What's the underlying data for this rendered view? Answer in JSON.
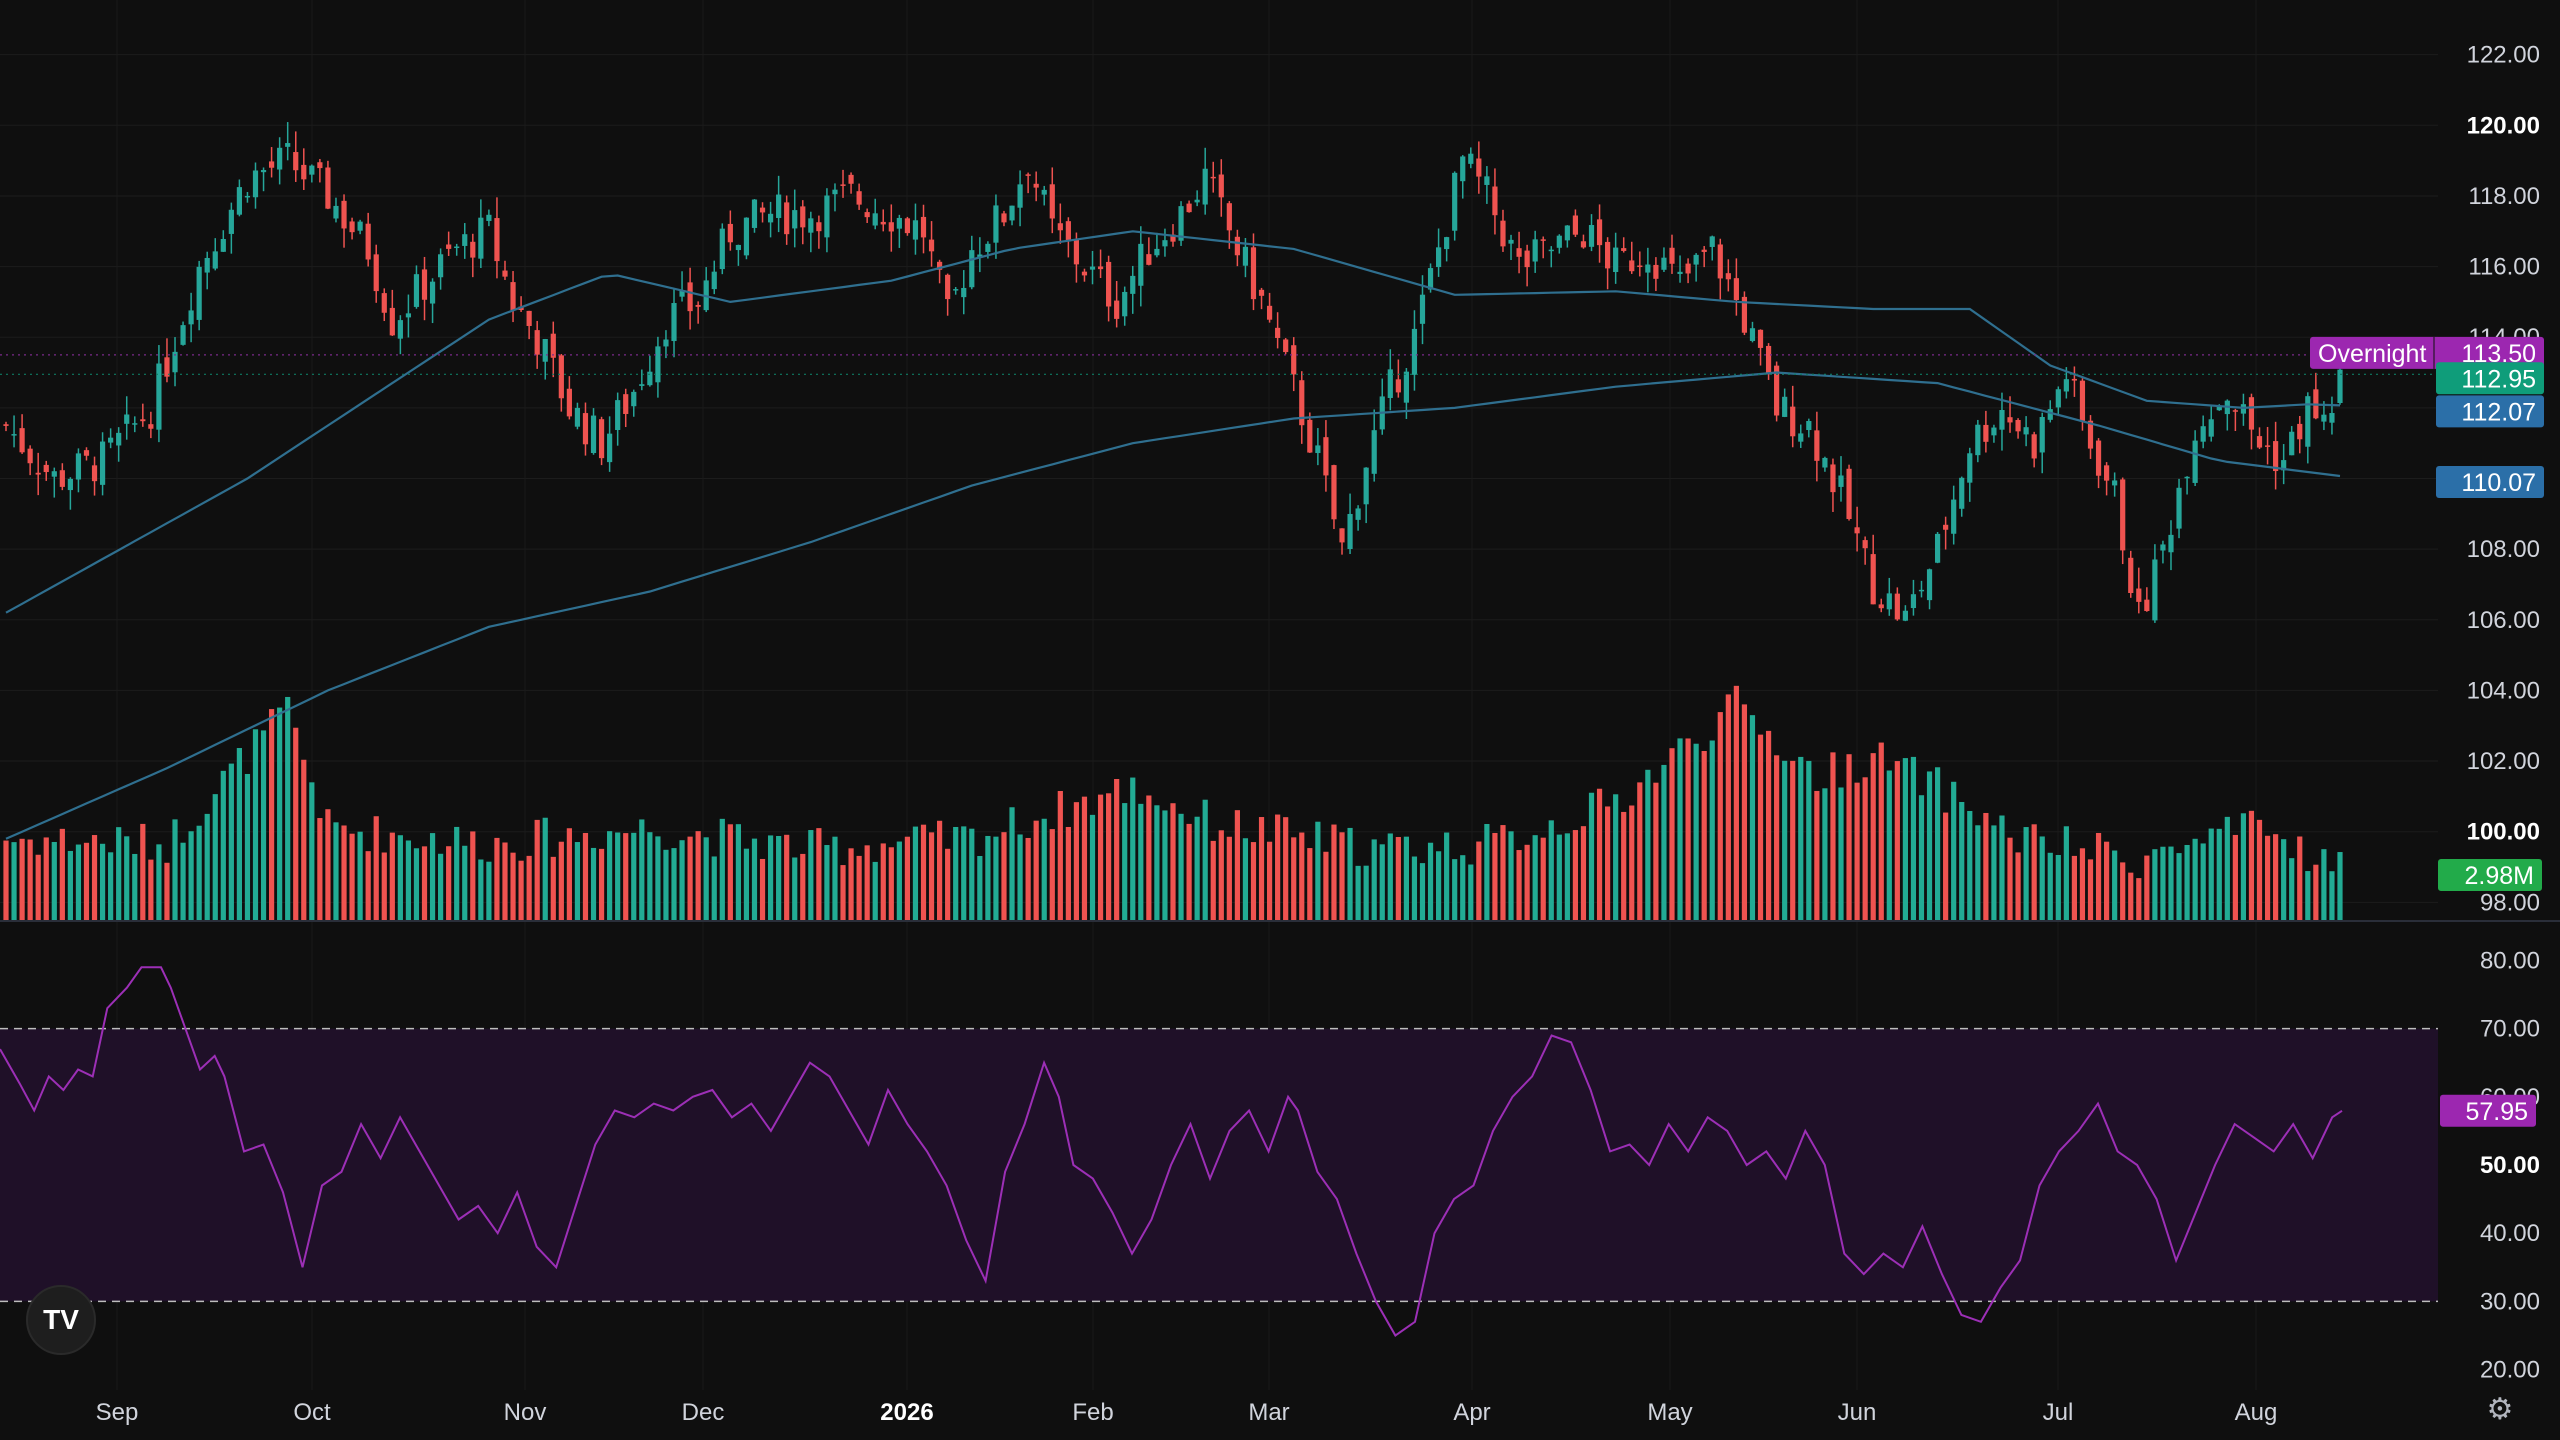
{
  "colors": {
    "background": "#0f0f0f",
    "up": "#26a69a",
    "up_volume": "#22ab94",
    "down": "#ef5350",
    "ma_line": "#2f6f8f",
    "rsi_line": "#9c2fb6",
    "rsi_band": "#1f1028",
    "overnight_tag": "#9c27b0",
    "last_price_tag": "#0f9d7a",
    "ma_tag": "#2b6fa8",
    "volume_tag": "#22ab4a",
    "rsi_tag": "#9c27b0"
  },
  "logo_text": "TV",
  "settings_icon": "gear-icon",
  "chart_data": [
    {
      "type": "candlestick",
      "panel": "price",
      "x_axis_labels": [
        "Sep",
        "Oct",
        "Nov",
        "Dec",
        "2026",
        "Feb",
        "Mar",
        "Apr",
        "May",
        "Jun",
        "Jul",
        "Aug"
      ],
      "y_tick_labels": [
        "122.00",
        "120.00",
        "118.00",
        "116.00",
        "114.00",
        "112.00",
        "110.00",
        "108.00",
        "106.00",
        "104.00",
        "102.00",
        "100.00",
        "98.00"
      ],
      "ylim": [
        97.5,
        122.5
      ],
      "close_anchors": [
        [
          0,
          111.5
        ],
        [
          6,
          110.0
        ],
        [
          12,
          110.5
        ],
        [
          18,
          112.0
        ],
        [
          24,
          116.0
        ],
        [
          30,
          118.5
        ],
        [
          35,
          119.0
        ],
        [
          40,
          118.0
        ],
        [
          45,
          116.5
        ],
        [
          48,
          114.5
        ],
        [
          52,
          115.5
        ],
        [
          56,
          116.5
        ],
        [
          60,
          117.0
        ],
        [
          63,
          115.0
        ],
        [
          66,
          114.0
        ],
        [
          70,
          112.0
        ],
        [
          74,
          111.0
        ],
        [
          78,
          112.5
        ],
        [
          82,
          114.5
        ],
        [
          86,
          115.0
        ],
        [
          90,
          117.0
        ],
        [
          95,
          117.5
        ],
        [
          100,
          117.5
        ],
        [
          105,
          118.0
        ],
        [
          110,
          117.5
        ],
        [
          114,
          117.0
        ],
        [
          117,
          114.5
        ],
        [
          120,
          116.5
        ],
        [
          124,
          117.5
        ],
        [
          127,
          119.0
        ],
        [
          130,
          117.0
        ],
        [
          134,
          116.0
        ],
        [
          138,
          115.0
        ],
        [
          142,
          116.5
        ],
        [
          146,
          117.5
        ],
        [
          149,
          118.5
        ],
        [
          152,
          117.0
        ],
        [
          156,
          115.0
        ],
        [
          160,
          112.5
        ],
        [
          163,
          110.5
        ],
        [
          166,
          108.0
        ],
        [
          169,
          110.5
        ],
        [
          172,
          112.5
        ],
        [
          175,
          114.0
        ],
        [
          178,
          116.5
        ],
        [
          181,
          119.0
        ],
        [
          184,
          118.0
        ],
        [
          188,
          116.0
        ],
        [
          192,
          116.5
        ],
        [
          196,
          117.0
        ],
        [
          200,
          116.0
        ],
        [
          204,
          116.5
        ],
        [
          208,
          115.5
        ],
        [
          212,
          116.5
        ],
        [
          216,
          114.5
        ],
        [
          220,
          112.0
        ],
        [
          224,
          111.5
        ],
        [
          228,
          109.5
        ],
        [
          232,
          107.0
        ],
        [
          236,
          106.0
        ],
        [
          240,
          108.0
        ],
        [
          244,
          111.0
        ],
        [
          248,
          112.0
        ],
        [
          252,
          111.0
        ],
        [
          256,
          113.0
        ],
        [
          258,
          111.5
        ],
        [
          262,
          109.5
        ],
        [
          265,
          106.0
        ],
        [
          268,
          108.0
        ],
        [
          272,
          111.5
        ],
        [
          276,
          112.5
        ],
        [
          280,
          111.0
        ],
        [
          283,
          110.5
        ],
        [
          286,
          112.0
        ],
        [
          288,
          111.5
        ],
        [
          290,
          112.8
        ]
      ],
      "ma_fast": [
        [
          0,
          106.2
        ],
        [
          30,
          110.0
        ],
        [
          60,
          114.5
        ],
        [
          75,
          115.8
        ],
        [
          90,
          115.0
        ],
        [
          110,
          115.6
        ],
        [
          125,
          116.5
        ],
        [
          140,
          117.0
        ],
        [
          160,
          116.5
        ],
        [
          180,
          115.2
        ],
        [
          200,
          115.3
        ],
        [
          215,
          115.0
        ],
        [
          232,
          114.8
        ],
        [
          244,
          114.8
        ],
        [
          254,
          113.2
        ],
        [
          266,
          112.2
        ],
        [
          278,
          112.0
        ],
        [
          286,
          112.1
        ],
        [
          290,
          112.07
        ]
      ],
      "ma_slow": [
        [
          0,
          99.8
        ],
        [
          20,
          101.8
        ],
        [
          40,
          104.0
        ],
        [
          60,
          105.8
        ],
        [
          80,
          106.8
        ],
        [
          100,
          108.2
        ],
        [
          120,
          109.8
        ],
        [
          140,
          111.0
        ],
        [
          160,
          111.7
        ],
        [
          180,
          112.0
        ],
        [
          200,
          112.6
        ],
        [
          220,
          113.0
        ],
        [
          240,
          112.7
        ],
        [
          260,
          111.5
        ],
        [
          275,
          110.5
        ],
        [
          290,
          110.07
        ]
      ],
      "price_tags": [
        {
          "label": "Overnight",
          "value": "113.50",
          "level": 113.5
        },
        {
          "label": "",
          "value": "112.95",
          "level": 112.95
        },
        {
          "label": "",
          "value": "112.07",
          "level": 112.07
        },
        {
          "label": "",
          "value": "110.07",
          "level": 110.07
        }
      ],
      "candle_count": 291
    },
    {
      "type": "bar",
      "panel": "volume",
      "last_value_label": "2.98M",
      "ylim": [
        0,
        4.5
      ],
      "volume_anchors": [
        [
          0,
          1.6
        ],
        [
          20,
          1.5
        ],
        [
          35,
          4.1
        ],
        [
          40,
          1.8
        ],
        [
          60,
          1.5
        ],
        [
          80,
          1.8
        ],
        [
          100,
          1.4
        ],
        [
          120,
          1.6
        ],
        [
          140,
          2.6
        ],
        [
          150,
          1.9
        ],
        [
          170,
          1.4
        ],
        [
          185,
          1.5
        ],
        [
          200,
          2.3
        ],
        [
          215,
          4.2
        ],
        [
          225,
          2.8
        ],
        [
          232,
          3.2
        ],
        [
          240,
          2.6
        ],
        [
          250,
          1.6
        ],
        [
          265,
          1.2
        ],
        [
          280,
          1.8
        ],
        [
          290,
          1.0
        ]
      ]
    },
    {
      "type": "line",
      "panel": "rsi",
      "y_tick_labels": [
        "80.00",
        "70.00",
        "60.00",
        "50.00",
        "40.00",
        "30.00",
        "20.00"
      ],
      "ylim": [
        17,
        83
      ],
      "band": [
        30,
        70
      ],
      "last_value_label": "57.95",
      "rsi_anchors": [
        [
          0,
          67
        ],
        [
          4,
          62
        ],
        [
          7,
          58
        ],
        [
          10,
          63
        ],
        [
          13,
          61
        ],
        [
          16,
          64
        ],
        [
          19,
          63
        ],
        [
          22,
          73
        ],
        [
          26,
          76
        ],
        [
          29,
          79
        ],
        [
          33,
          79
        ],
        [
          35,
          76
        ],
        [
          38,
          70
        ],
        [
          41,
          64
        ],
        [
          44,
          66
        ],
        [
          46,
          63
        ],
        [
          50,
          52
        ],
        [
          54,
          53
        ],
        [
          58,
          46
        ],
        [
          62,
          35
        ],
        [
          66,
          47
        ],
        [
          70,
          49
        ],
        [
          74,
          56
        ],
        [
          78,
          51
        ],
        [
          82,
          57
        ],
        [
          86,
          52
        ],
        [
          90,
          47
        ],
        [
          94,
          42
        ],
        [
          98,
          44
        ],
        [
          102,
          40
        ],
        [
          106,
          46
        ],
        [
          110,
          38
        ],
        [
          114,
          35
        ],
        [
          118,
          44
        ],
        [
          122,
          53
        ],
        [
          126,
          58
        ],
        [
          130,
          57
        ],
        [
          134,
          59
        ],
        [
          138,
          58
        ],
        [
          142,
          60
        ],
        [
          146,
          61
        ],
        [
          150,
          57
        ],
        [
          154,
          59
        ],
        [
          158,
          55
        ],
        [
          162,
          60
        ],
        [
          166,
          65
        ],
        [
          170,
          63
        ],
        [
          174,
          58
        ],
        [
          178,
          53
        ],
        [
          182,
          61
        ],
        [
          186,
          56
        ],
        [
          190,
          52
        ],
        [
          194,
          47
        ],
        [
          198,
          39
        ],
        [
          202,
          33
        ],
        [
          206,
          49
        ],
        [
          210,
          56
        ],
        [
          214,
          65
        ],
        [
          217,
          60
        ],
        [
          220,
          50
        ],
        [
          224,
          48
        ],
        [
          228,
          43
        ],
        [
          232,
          37
        ],
        [
          236,
          42
        ],
        [
          240,
          50
        ],
        [
          244,
          56
        ],
        [
          248,
          48
        ],
        [
          252,
          55
        ],
        [
          256,
          58
        ],
        [
          260,
          52
        ],
        [
          264,
          60
        ],
        [
          266,
          58
        ],
        [
          270,
          49
        ],
        [
          274,
          45
        ],
        [
          278,
          37
        ],
        [
          282,
          30
        ],
        [
          286,
          25
        ],
        [
          290,
          27
        ],
        [
          294,
          40
        ],
        [
          298,
          45
        ],
        [
          302,
          47
        ],
        [
          306,
          55
        ],
        [
          310,
          60
        ],
        [
          314,
          63
        ],
        [
          318,
          69
        ],
        [
          322,
          68
        ],
        [
          326,
          61
        ],
        [
          330,
          52
        ],
        [
          334,
          53
        ],
        [
          338,
          50
        ],
        [
          342,
          56
        ],
        [
          346,
          52
        ],
        [
          350,
          57
        ],
        [
          354,
          55
        ],
        [
          358,
          50
        ],
        [
          362,
          52
        ],
        [
          366,
          48
        ],
        [
          370,
          55
        ],
        [
          374,
          50
        ],
        [
          378,
          37
        ],
        [
          382,
          34
        ],
        [
          386,
          37
        ],
        [
          390,
          35
        ],
        [
          394,
          41
        ],
        [
          398,
          34
        ],
        [
          402,
          28
        ],
        [
          406,
          27
        ],
        [
          410,
          32
        ],
        [
          414,
          36
        ],
        [
          418,
          47
        ],
        [
          422,
          52
        ],
        [
          426,
          55
        ],
        [
          430,
          59
        ],
        [
          434,
          52
        ],
        [
          438,
          50
        ],
        [
          442,
          45
        ],
        [
          446,
          36
        ],
        [
          450,
          43
        ],
        [
          454,
          50
        ],
        [
          458,
          56
        ],
        [
          462,
          54
        ],
        [
          466,
          52
        ],
        [
          470,
          56
        ],
        [
          474,
          51
        ],
        [
          478,
          57
        ],
        [
          480,
          57.95
        ]
      ]
    }
  ]
}
